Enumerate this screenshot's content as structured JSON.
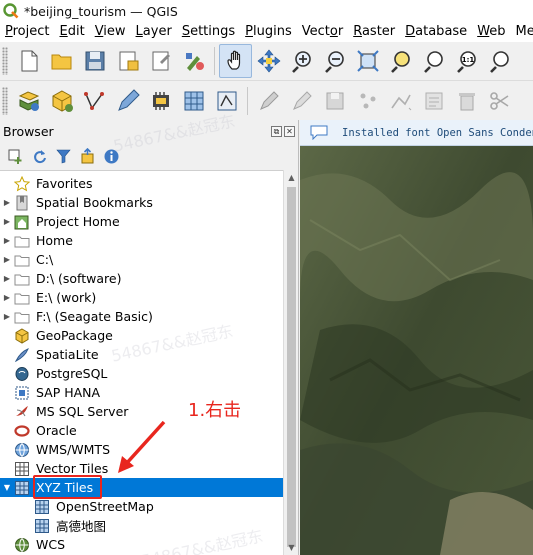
{
  "window": {
    "title": "*beijing_tourism — QGIS"
  },
  "menubar": {
    "items": [
      {
        "label": "Project",
        "key": "P"
      },
      {
        "label": "Edit",
        "key": "E"
      },
      {
        "label": "View",
        "key": "V"
      },
      {
        "label": "Layer",
        "key": "L"
      },
      {
        "label": "Settings",
        "key": "S"
      },
      {
        "label": "Plugins",
        "key": "P"
      },
      {
        "label": "Vector",
        "key": "o"
      },
      {
        "label": "Raster",
        "key": "R"
      },
      {
        "label": "Database",
        "key": "D"
      },
      {
        "label": "Web",
        "key": "W"
      },
      {
        "label": "Me",
        "key": ""
      }
    ]
  },
  "browser": {
    "title": "Browser",
    "items": [
      {
        "label": "Favorites",
        "icon": "star-icon",
        "arrow": ""
      },
      {
        "label": "Spatial Bookmarks",
        "icon": "bookmark-icon",
        "arrow": "▶"
      },
      {
        "label": "Project Home",
        "icon": "project-home-icon",
        "arrow": "▶"
      },
      {
        "label": "Home",
        "icon": "folder-icon",
        "arrow": "▶"
      },
      {
        "label": "C:\\",
        "icon": "folder-icon",
        "arrow": "▶"
      },
      {
        "label": "D:\\ (software)",
        "icon": "folder-icon",
        "arrow": "▶"
      },
      {
        "label": "E:\\ (work)",
        "icon": "folder-icon",
        "arrow": "▶"
      },
      {
        "label": "F:\\ (Seagate Basic)",
        "icon": "folder-icon",
        "arrow": "▶"
      },
      {
        "label": "GeoPackage",
        "icon": "geopackage-icon",
        "arrow": ""
      },
      {
        "label": "SpatiaLite",
        "icon": "spatialite-icon",
        "arrow": ""
      },
      {
        "label": "PostgreSQL",
        "icon": "postgresql-icon",
        "arrow": ""
      },
      {
        "label": "SAP HANA",
        "icon": "sap-hana-icon",
        "arrow": ""
      },
      {
        "label": "MS SQL Server",
        "icon": "mssql-icon",
        "arrow": ""
      },
      {
        "label": "Oracle",
        "icon": "oracle-icon",
        "arrow": ""
      },
      {
        "label": "WMS/WMTS",
        "icon": "wms-icon",
        "arrow": ""
      },
      {
        "label": "Vector Tiles",
        "icon": "vector-tiles-icon",
        "arrow": ""
      },
      {
        "label": "XYZ Tiles",
        "icon": "xyz-tiles-icon",
        "arrow": "▼",
        "selected": true
      },
      {
        "label": "OpenStreetMap",
        "icon": "xyz-layer-icon",
        "arrow": "",
        "child": true
      },
      {
        "label": "高德地图",
        "icon": "xyz-layer-icon",
        "arrow": "",
        "child": true
      },
      {
        "label": "WCS",
        "icon": "wcs-icon",
        "arrow": ""
      }
    ]
  },
  "message_bar": {
    "text": "Installed font Open Sans Condens"
  },
  "annotation": {
    "label": "1.右击",
    "color": "#e8261e"
  },
  "watermark": {
    "text": "54867&&赵冠东"
  },
  "colors": {
    "selection": "#0078d7",
    "annotation": "#e8261e"
  }
}
